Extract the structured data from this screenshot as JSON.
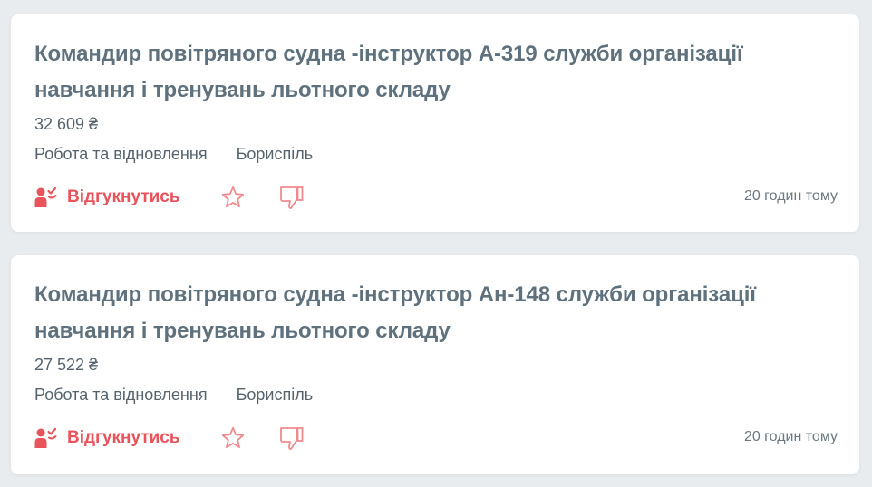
{
  "colors": {
    "accent": "#e9535c",
    "title": "#5f717d",
    "text": "#56636c",
    "background": "#e9ecef"
  },
  "vacancies": [
    {
      "title": "Командир повітряного судна -інструктор А-319 служби організації навчання і тренувань льотного складу",
      "salary": "32 609 ₴",
      "category": "Робота та відновлення",
      "city": "Бориспіль",
      "respond_label": "Відгукнутись",
      "respond_icon": "person-check-icon",
      "favorite_icon": "star-icon",
      "dislike_icon": "thumbs-down-icon",
      "posted": "20 годин тому"
    },
    {
      "title": "Командир повітряного судна -інструктор Ан-148 служби організації навчання і тренувань льотного складу",
      "salary": "27 522 ₴",
      "category": "Робота та відновлення",
      "city": "Бориспіль",
      "respond_label": "Відгукнутись",
      "respond_icon": "person-check-icon",
      "favorite_icon": "star-icon",
      "dislike_icon": "thumbs-down-icon",
      "posted": "20 годин тому"
    }
  ]
}
